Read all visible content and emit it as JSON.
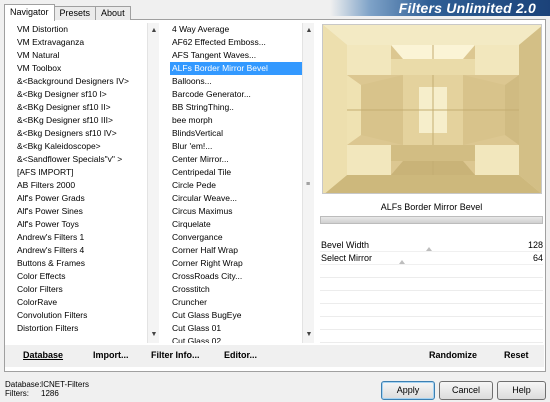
{
  "app": {
    "title": "Filters Unlimited 2.0"
  },
  "tabs": [
    {
      "label": "Navigator",
      "active": true
    },
    {
      "label": "Presets",
      "active": false
    },
    {
      "label": "About",
      "active": false
    }
  ],
  "categories": [
    "VM Distortion",
    "VM Extravaganza",
    "VM Natural",
    "VM Toolbox",
    "&<Background Designers IV>",
    "&<Bkg Designer sf10 I>",
    "&<BKg Designer sf10 II>",
    "&<BKg Designer sf10 III>",
    "&<Bkg Designers sf10 IV>",
    "&<Bkg Kaleidoscope>",
    "&<Sandflower Specials\"v\" >",
    "[AFS IMPORT]",
    "AB Filters 2000",
    "Alf's Power Grads",
    "Alf's Power Sines",
    "Alf's Power Toys",
    "Andrew's Filters 1",
    "Andrew's Filters 4",
    "Buttons & Frames",
    "Color Effects",
    "Color Filters",
    "ColorRave",
    "Convolution Filters",
    "Distortion Filters"
  ],
  "categories_selected": "&<Bkg Designer sf10 I>",
  "filters": [
    "4 Way Average",
    "AF62 Effected Emboss...",
    "AFS Tangent Waves...",
    "ALFs Border Mirror Bevel",
    "Balloons...",
    "Barcode Generator...",
    "BB StringThing..",
    "bee morph",
    "BlindsVertical",
    "Blur 'em!...",
    "Center Mirror...",
    "Centripedal Tile",
    "Circle Pede",
    "Circular Weave...",
    "Circus Maximus",
    "Cirquelate",
    "Convergance",
    "Corner Half Wrap",
    "Corner Right Wrap",
    "CrossRoads City...",
    "Crosstitch",
    "Cruncher",
    "Cut Glass  BugEye",
    "Cut Glass 01",
    "Cut Glass 02"
  ],
  "filters_selected": "ALFs Border Mirror Bevel",
  "selected_filter_name": "ALFs Border Mirror Bevel",
  "params": [
    {
      "label": "Bevel Width",
      "value": "128",
      "fraction": 0.5
    },
    {
      "label": "Select Mirror",
      "value": "64",
      "fraction": 0.25
    }
  ],
  "actions": {
    "database": "Database",
    "import": "Import...",
    "filter_info": "Filter Info...",
    "editor": "Editor...",
    "randomize": "Randomize",
    "reset": "Reset"
  },
  "footer": {
    "database_label": "Database:",
    "database_value": "ICNET-Filters",
    "filters_label": "Filters:",
    "filters_value": "1286"
  },
  "buttons": {
    "apply": "Apply",
    "cancel": "Cancel",
    "help": "Help"
  },
  "colors": {
    "selection": "#3399ff",
    "banner_dark": "#1b4279",
    "preview_tan": "#d8c592",
    "preview_light": "#f4ecc6"
  }
}
